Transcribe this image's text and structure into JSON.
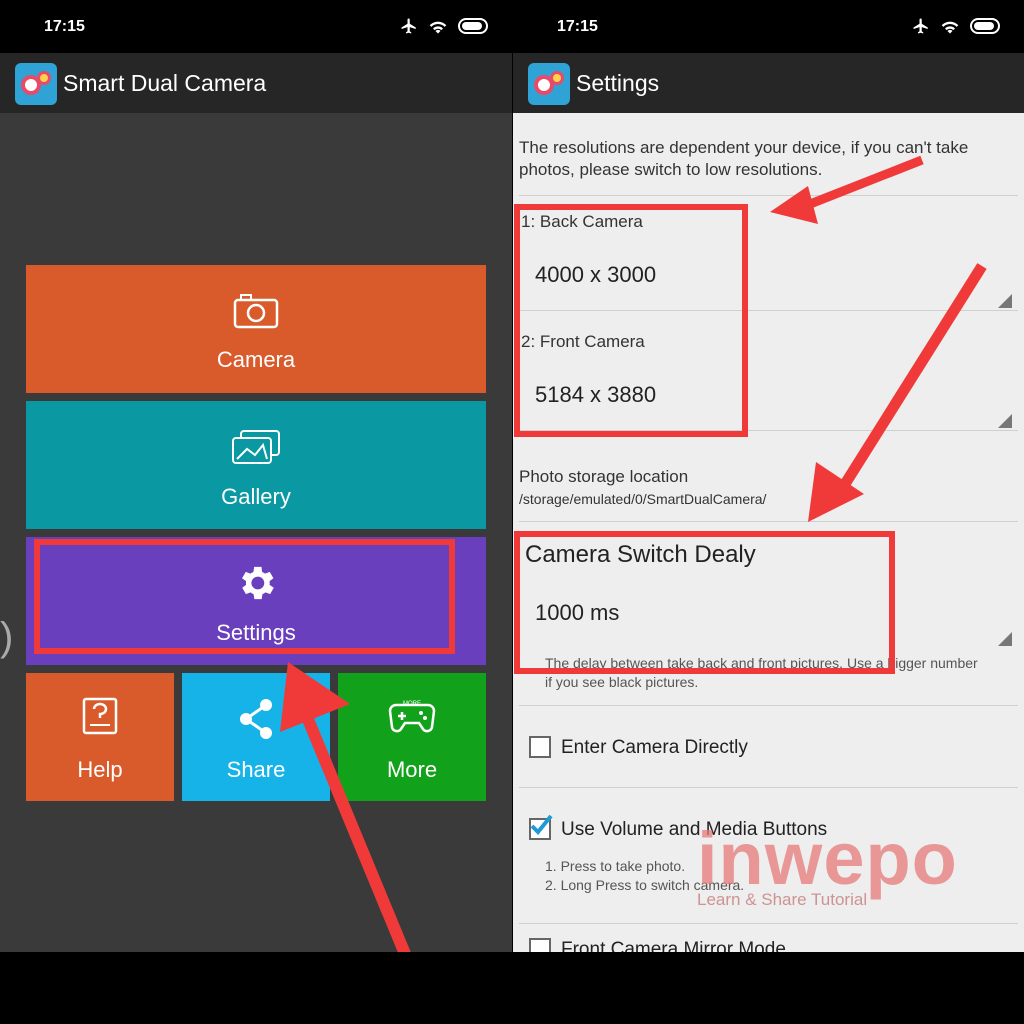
{
  "status_bar": {
    "time": "17:15"
  },
  "left_screen": {
    "app_title": "Smart Dual Camera",
    "tiles": {
      "camera": "Camera",
      "gallery": "Gallery",
      "settings": "Settings",
      "help": "Help",
      "share": "Share",
      "more": "More"
    },
    "more_icon_text": "MORE",
    "colors": {
      "camera": "#d95a2b",
      "gallery": "#0a98a2",
      "settings": "#6a3fbd",
      "help": "#d95a2b",
      "share": "#16b3e8",
      "more": "#12a11b"
    }
  },
  "right_screen": {
    "app_title": "Settings",
    "resolution_note": "The resolutions are dependent your device, if you can't take photos, please switch to low resolutions.",
    "back_camera": {
      "label": "1: Back Camera",
      "value": "4000 x 3000"
    },
    "front_camera": {
      "label": "2: Front Camera",
      "value": "5184 x 3880"
    },
    "storage": {
      "label": "Photo storage location",
      "value": "/storage/emulated/0/SmartDualCamera/"
    },
    "switch_delay": {
      "label": "Camera Switch Dealy",
      "value": "1000 ms",
      "description": "The delay between take back and front pictures. Use a bigger number if you see black pictures."
    },
    "enter_camera_directly": {
      "label": "Enter Camera Directly",
      "checked": false
    },
    "volume_buttons": {
      "label": "Use Volume and Media Buttons",
      "checked": true,
      "line1": "1. Press to take photo.",
      "line2": "2. Long Press to switch camera."
    },
    "next_item_partial": "Front Camera Mirror Mode"
  },
  "watermark": {
    "brand": "inwepo",
    "tagline": "Learn & Share Tutorial"
  },
  "annotation_color": "#f03a3a"
}
